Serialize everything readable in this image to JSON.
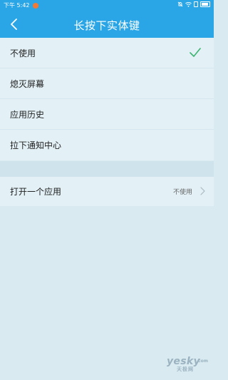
{
  "status_bar": {
    "time": "下午 5:42",
    "notification_color": "#f07a35",
    "icons": [
      "alarm-off-icon",
      "wifi-icon",
      "sim-icon",
      "battery-icon"
    ]
  },
  "header": {
    "back_icon": "chevron-left-icon",
    "title": "长按下实体键",
    "background": "#2aa5e6"
  },
  "options": {
    "items": [
      {
        "label": "不使用",
        "selected": true
      },
      {
        "label": "熄灭屏幕",
        "selected": false
      },
      {
        "label": "应用历史",
        "selected": false
      },
      {
        "label": "拉下通知中心",
        "selected": false
      }
    ],
    "check_color": "#3cb371"
  },
  "app_setting": {
    "label": "打开一个应用",
    "value": "不使用"
  },
  "watermark": {
    "main": "yesky",
    "suffix": ".com",
    "sub": "天极网"
  }
}
